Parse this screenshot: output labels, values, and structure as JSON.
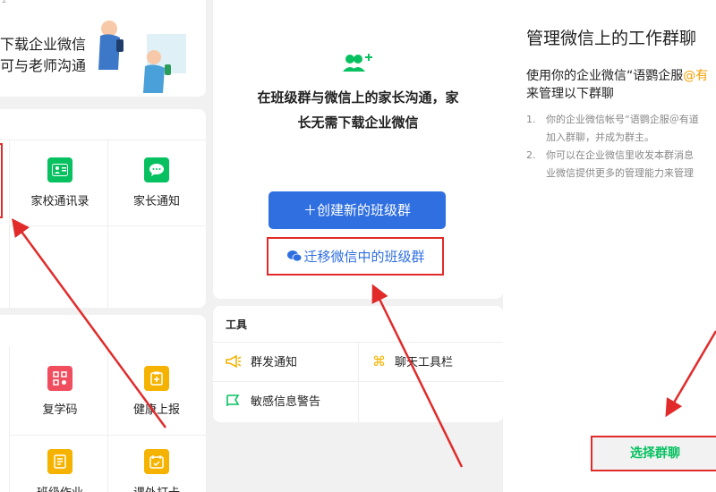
{
  "panel1": {
    "banner": {
      "line1": "下载企业微信",
      "line2": "可与老师沟通",
      "top_fragment": "2"
    },
    "grid1": [
      {
        "label": "家校通讯录",
        "icon": "contacts-icon",
        "color": "#07c160"
      },
      {
        "label": "家长通知",
        "icon": "chat-bubble-icon",
        "color": "#07c160"
      }
    ],
    "grid2": [
      {
        "label": "复学码",
        "icon": "qrcode-icon",
        "color": "#f04e5f"
      },
      {
        "label": "健康上报",
        "icon": "health-report-icon",
        "color": "#f5b300"
      },
      {
        "label": "班级作业",
        "icon": "homework-icon",
        "color": "#f5b300"
      },
      {
        "label": "课外打卡",
        "icon": "checkin-icon",
        "color": "#f5b300"
      }
    ]
  },
  "panel2": {
    "intro_line1": "在班级群与微信上的家长沟通，家",
    "intro_line2": "长无需下载企业微信",
    "create_button": "＋创建新的班级群",
    "migrate_button": "迁移微信中的班级群",
    "tools": {
      "title": "工具",
      "items": [
        {
          "label": "群发通知",
          "icon": "megaphone-icon",
          "color": "#f5b300"
        },
        {
          "label": "聊天工具栏",
          "icon": "command-icon",
          "color": "#f5b300"
        },
        {
          "label": "敏感信息警告",
          "icon": "flag-icon",
          "color": "#07c160"
        }
      ]
    },
    "colors": {
      "primary": "#2f6fe0",
      "wechat_green": "#07c160"
    }
  },
  "panel3": {
    "title": "管理微信上的工作群聊",
    "subtitle_line1_a": "使用你的企业微信“语鹦企服",
    "subtitle_at": "@",
    "subtitle_line1_b": "有",
    "subtitle_line2": "来管理以下群聊",
    "steps": [
      {
        "num": "1.",
        "line1": "你的企业微信帐号“语鹦企服＠有道",
        "line2": "加入群聊，并成为群主。"
      },
      {
        "num": "2.",
        "line1": "你可以在企业微信里收发本群消息",
        "line2": "业微信提供更多的管理能力来管理"
      }
    ],
    "select_button": "选择群聊"
  }
}
